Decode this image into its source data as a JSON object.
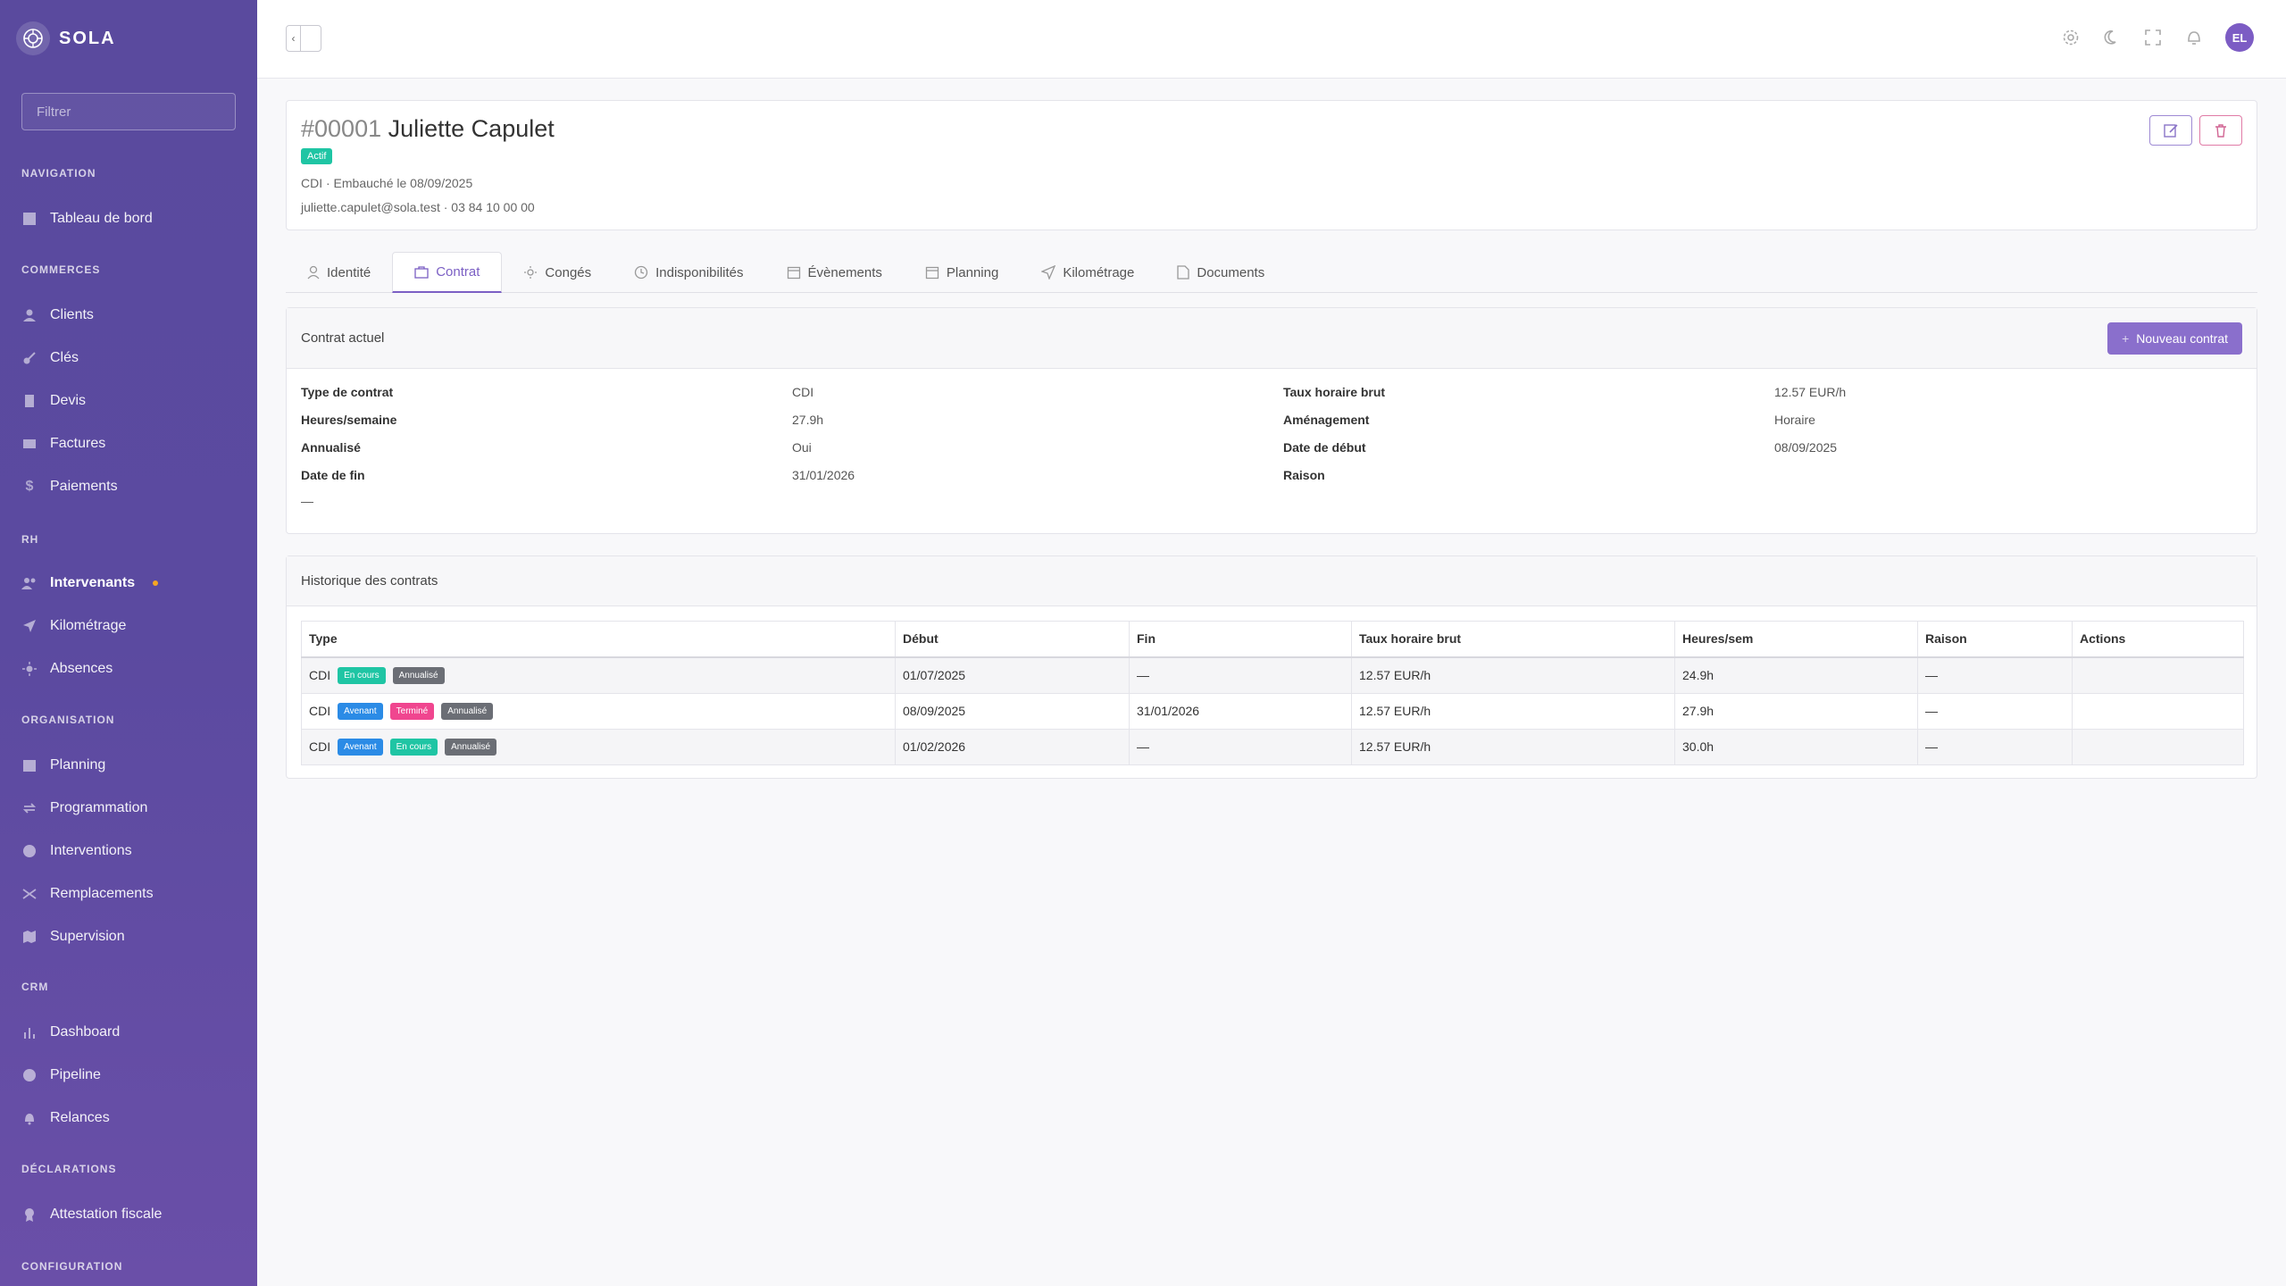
{
  "brand": {
    "name": "SOLA"
  },
  "sidebar": {
    "filter_placeholder": "Filtrer",
    "sections": {
      "navigation": "NAVIGATION",
      "commerces": "COMMERCES",
      "rh": "RH",
      "organisation": "ORGANISATION",
      "crm": "CRM",
      "declarations": "DÉCLARATIONS",
      "configuration": "CONFIGURATION"
    },
    "items": {
      "tableau": "Tableau de bord",
      "clients": "Clients",
      "cles": "Clés",
      "devis": "Devis",
      "factures": "Factures",
      "paiements": "Paiements",
      "intervenants": "Intervenants",
      "kilometrage": "Kilométrage",
      "absences": "Absences",
      "planning": "Planning",
      "programmation": "Programmation",
      "interventions": "Interventions",
      "remplacements": "Remplacements",
      "supervision": "Supervision",
      "dashboard": "Dashboard",
      "pipeline": "Pipeline",
      "relances": "Relances",
      "attestation": "Attestation fiscale"
    }
  },
  "topbar": {
    "avatar_initials": "EL"
  },
  "employee": {
    "number": "#00001",
    "name": "Juliette Capulet",
    "status": "Actif",
    "meta": "CDI · Embauché le 08/09/2025",
    "contact": "juliette.capulet@sola.test · 03 84 10 00 00"
  },
  "tabs": {
    "identite": "Identité",
    "contrat": "Contrat",
    "conges": "Congés",
    "indispo": "Indisponibilités",
    "evenements": "Évènements",
    "planning": "Planning",
    "kilometrage": "Kilométrage",
    "documents": "Documents"
  },
  "contract": {
    "title": "Contrat actuel",
    "new_button": "Nouveau contrat",
    "fields": {
      "type_k": "Type de contrat",
      "type_v": "CDI",
      "taux_k": "Taux horaire brut",
      "taux_v": "12.57 EUR/h",
      "heures_k": "Heures/semaine",
      "heures_v": "27.9h",
      "amenagement_k": "Aménagement",
      "amenagement_v": "Horaire",
      "annualise_k": "Annualisé",
      "annualise_v": "Oui",
      "debut_k": "Date de début",
      "debut_v": "08/09/2025",
      "fin_k": "Date de fin",
      "fin_v": "31/01/2026",
      "raison_k": "Raison",
      "raison_v": "—"
    }
  },
  "history": {
    "title": "Historique des contrats",
    "headers": {
      "type": "Type",
      "debut": "Début",
      "fin": "Fin",
      "taux": "Taux horaire brut",
      "heures": "Heures/sem",
      "raison": "Raison",
      "actions": "Actions"
    },
    "rows": [
      {
        "type": "CDI",
        "badges": {
          "a": "En cours",
          "b": "Annualisé"
        },
        "debut": "01/07/2025",
        "fin": "—",
        "taux": "12.57 EUR/h",
        "heures": "24.9h",
        "raison": "—"
      },
      {
        "type": "CDI",
        "badges": {
          "a": "Avenant",
          "b": "Terminé",
          "c": "Annualisé"
        },
        "debut": "08/09/2025",
        "fin": "31/01/2026",
        "taux": "12.57 EUR/h",
        "heures": "27.9h",
        "raison": "—"
      },
      {
        "type": "CDI",
        "badges": {
          "a": "Avenant",
          "b": "En cours",
          "c": "Annualisé"
        },
        "debut": "01/02/2026",
        "fin": "—",
        "taux": "12.57 EUR/h",
        "heures": "30.0h",
        "raison": "—"
      }
    ]
  },
  "colors": {
    "accent": "#7b5fc4",
    "sidebar": "#5a4a9e",
    "success": "#1fc5a4",
    "info": "#2b8be6",
    "danger": "#f0468f"
  }
}
